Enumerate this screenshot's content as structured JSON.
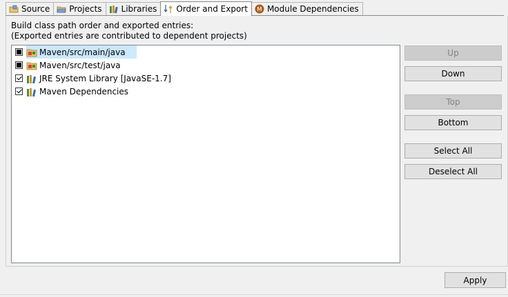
{
  "tabs": [
    {
      "label": "Source",
      "icon": "source-folder-icon"
    },
    {
      "label": "Projects",
      "icon": "projects-folder-icon"
    },
    {
      "label": "Libraries",
      "icon": "libraries-icon"
    },
    {
      "label": "Order and Export",
      "icon": "order-export-icon",
      "active": true
    },
    {
      "label": "Module Dependencies",
      "icon": "module-icon"
    }
  ],
  "description": {
    "line1": "Build class path order and exported entries:",
    "line2": "(Exported entries are contributed to dependent projects)"
  },
  "entries": [
    {
      "label": "Maven/src/main/java",
      "state": "indeterminate",
      "icon": "source-folder-icon",
      "selected": true
    },
    {
      "label": "Maven/src/test/java",
      "state": "indeterminate",
      "icon": "source-folder-icon",
      "selected": false
    },
    {
      "label": "JRE System Library [JavaSE-1.7]",
      "state": "checked",
      "icon": "library-icon",
      "selected": false
    },
    {
      "label": "Maven Dependencies",
      "state": "checked",
      "icon": "library-icon",
      "selected": false
    }
  ],
  "buttons": {
    "up": "Up",
    "down": "Down",
    "top": "Top",
    "bottom": "Bottom",
    "select_all": "Select All",
    "deselect_all": "Deselect All"
  },
  "apply_label": "Apply"
}
